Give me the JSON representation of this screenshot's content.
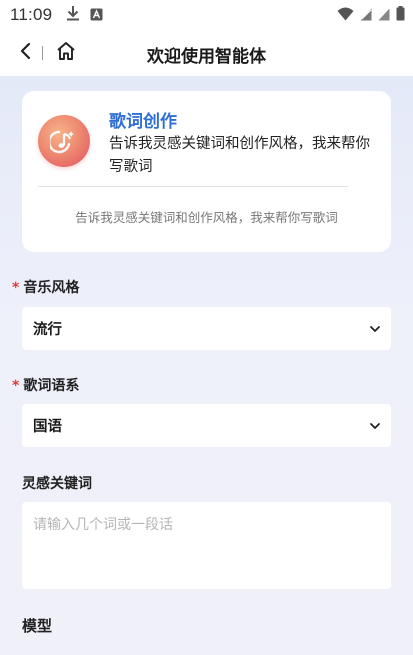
{
  "status_bar": {
    "time": "11:09",
    "icons": [
      "download-icon",
      "app-notification-icon",
      "wifi-icon",
      "signal-icon",
      "signal-icon",
      "battery-icon"
    ]
  },
  "nav": {
    "title": "欢迎使用智能体",
    "back_icon": "chevron-left-icon",
    "home_icon": "home-icon"
  },
  "agent_card": {
    "name": "歌词创作",
    "description": "告诉我灵感关键词和创作风格，我来帮你写歌词",
    "hint": "告诉我灵感关键词和创作风格，我来帮你写歌词",
    "icon": "music-note-icon"
  },
  "form": {
    "music_style": {
      "label": "音乐风格",
      "required": "*",
      "value": "流行"
    },
    "lyrics_language": {
      "label": "歌词语系",
      "required": "*",
      "value": "国语"
    },
    "inspiration_keywords": {
      "label": "灵感关键词",
      "placeholder": "请输入几个词或一段话"
    },
    "model": {
      "label": "模型"
    }
  },
  "colors": {
    "accent": "#2f6fd4",
    "required": "#e23a3a",
    "background_top": "#dfe6f8",
    "background_bottom": "#f0f1f8"
  }
}
